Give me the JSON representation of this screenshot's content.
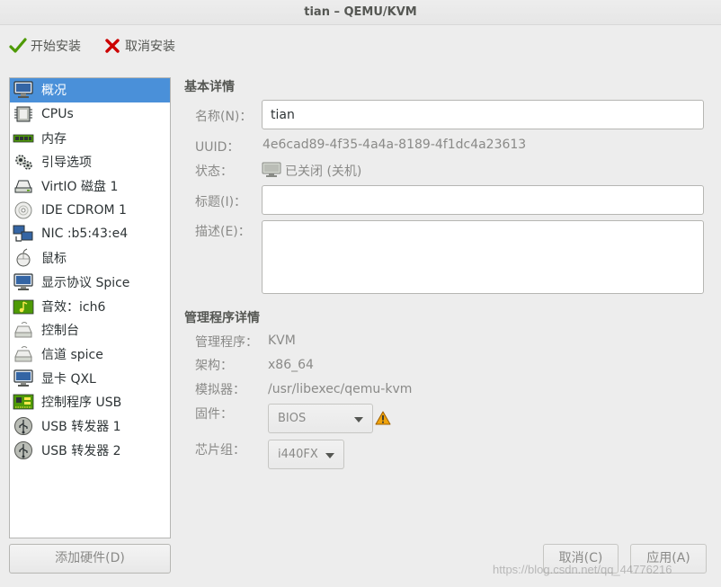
{
  "window": {
    "title": "tian – QEMU/KVM"
  },
  "toolbar": {
    "begin_install": "开始安装",
    "cancel_install": "取消安装"
  },
  "sidebar": {
    "items": [
      {
        "label": "概况",
        "icon": "monitor-icon",
        "selected": true
      },
      {
        "label": "CPUs",
        "icon": "cpu-icon"
      },
      {
        "label": "内存",
        "icon": "memory-icon"
      },
      {
        "label": "引导选项",
        "icon": "boot-options-icon"
      },
      {
        "label": "VirtIO 磁盘 1",
        "icon": "disk-icon"
      },
      {
        "label": "IDE CDROM 1",
        "icon": "cdrom-icon"
      },
      {
        "label": "NIC :b5:43:e4",
        "icon": "network-icon"
      },
      {
        "label": "鼠标",
        "icon": "mouse-icon"
      },
      {
        "label": "显示协议 Spice",
        "icon": "display-icon"
      },
      {
        "label": "音效：ich6",
        "icon": "sound-icon"
      },
      {
        "label": "控制台",
        "icon": "serial-icon"
      },
      {
        "label": "信道 spice",
        "icon": "channel-icon"
      },
      {
        "label": "显卡 QXL",
        "icon": "video-card-icon"
      },
      {
        "label": "控制程序 USB",
        "icon": "controller-icon"
      },
      {
        "label": "USB 转发器 1",
        "icon": "usb-icon"
      },
      {
        "label": "USB 转发器 2",
        "icon": "usb-icon"
      }
    ],
    "add_hardware": "添加硬件(D)"
  },
  "basic": {
    "title": "基本详情",
    "name_label": "名称(N)：",
    "name_value": "tian",
    "uuid_label": "UUID：",
    "uuid_value": "4e6cad89-4f35-4a4a-8189-4f1dc4a23613",
    "status_label": "状态：",
    "status_value": "已关闭 (关机)",
    "title_label": "标题(I)：",
    "title_value": "",
    "desc_label": "描述(E)：",
    "desc_value": ""
  },
  "hypervisor": {
    "title": "管理程序详情",
    "hv_label": "管理程序：",
    "hv_value": "KVM",
    "arch_label": "架构：",
    "arch_value": "x86_64",
    "emu_label": "模拟器：",
    "emu_value": "/usr/libexec/qemu-kvm",
    "firmware_label": "固件：",
    "firmware_value": "BIOS",
    "chipset_label": "芯片组：",
    "chipset_value": "i440FX"
  },
  "actions": {
    "cancel": "取消(C)",
    "apply": "应用(A)"
  },
  "watermark": "https://blog.csdn.net/qq_44776216",
  "colors": {
    "selection": "#4a90d9",
    "install_check": "#4e9a06",
    "cancel_x": "#cc0000",
    "warning": "#f0a30a"
  }
}
